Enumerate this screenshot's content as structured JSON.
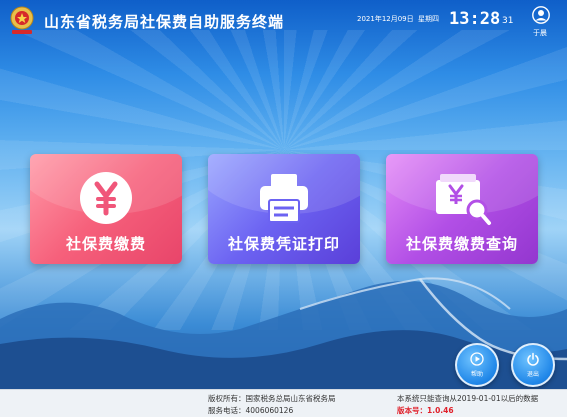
{
  "header": {
    "app_title": "山东省税务局社保费自助服务终端",
    "date": "2021年12月09日",
    "weekday": "星期四",
    "time_hm": "13:28",
    "time_s": "31",
    "user_name": "于晨"
  },
  "tiles": [
    {
      "label": "社保费缴费",
      "icon": "yuan-coin-icon",
      "color": "#f6607b"
    },
    {
      "label": "社保费凭证打印",
      "icon": "printer-icon",
      "color": "#6c63f2"
    },
    {
      "label": "社保费缴费查询",
      "icon": "wallet-search-icon",
      "color": "#b24fe6"
    }
  ],
  "buttons": {
    "help_label": "帮助",
    "exit_label": "退出"
  },
  "footer": {
    "copyright": "版权所有：国家税务总局山东省税务局",
    "phone": "服务电话：4006060126",
    "notice": "本系统只能查询从2019-01-01以后的数据",
    "version": "版本号：1.0.46"
  }
}
